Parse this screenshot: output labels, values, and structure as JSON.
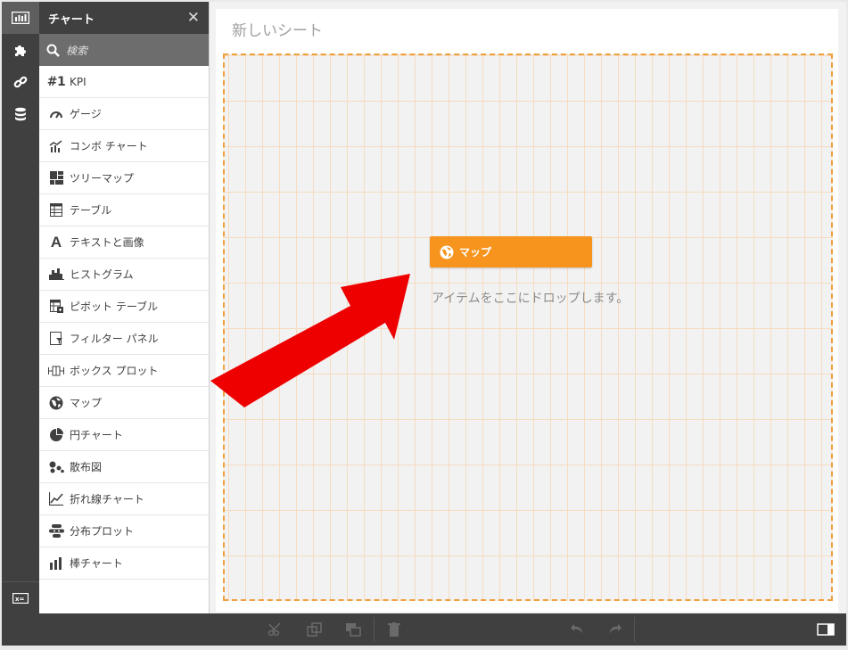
{
  "rail": {
    "items": [
      {
        "icon": "charts-icon",
        "active": true
      },
      {
        "icon": "extensions-icon",
        "active": false
      },
      {
        "icon": "link-icon",
        "active": false
      },
      {
        "icon": "database-icon",
        "active": false
      }
    ],
    "bottom_icon": "master-items-icon"
  },
  "panel": {
    "title": "チャート",
    "close_glyph": "✕",
    "search_placeholder": "検索",
    "items": [
      {
        "label": "KPI",
        "icon": "kpi-icon",
        "glyph": "#1"
      },
      {
        "label": "ゲージ",
        "icon": "gauge-icon"
      },
      {
        "label": "コンボ チャート",
        "icon": "combo-chart-icon"
      },
      {
        "label": "ツリーマップ",
        "icon": "treemap-icon"
      },
      {
        "label": "テーブル",
        "icon": "table-icon"
      },
      {
        "label": "テキストと画像",
        "icon": "text-image-icon",
        "glyph": "A"
      },
      {
        "label": "ヒストグラム",
        "icon": "histogram-icon"
      },
      {
        "label": "ピボット テーブル",
        "icon": "pivot-table-icon"
      },
      {
        "label": "フィルター パネル",
        "icon": "filter-pane-icon"
      },
      {
        "label": "ボックス プロット",
        "icon": "box-plot-icon"
      },
      {
        "label": "マップ",
        "icon": "map-icon"
      },
      {
        "label": "円チャート",
        "icon": "pie-chart-icon"
      },
      {
        "label": "散布図",
        "icon": "scatter-icon"
      },
      {
        "label": "折れ線チャート",
        "icon": "line-chart-icon"
      },
      {
        "label": "分布プロット",
        "icon": "distribution-plot-icon"
      },
      {
        "label": "棒チャート",
        "icon": "bar-chart-icon"
      }
    ]
  },
  "sheet": {
    "title": "新しいシート",
    "drag_item_label": "マップ",
    "drop_hint": "アイテムをここにドロップします。"
  },
  "colors": {
    "accent": "#f7941d",
    "arrow": "#ee0000",
    "rail": "#404040"
  }
}
